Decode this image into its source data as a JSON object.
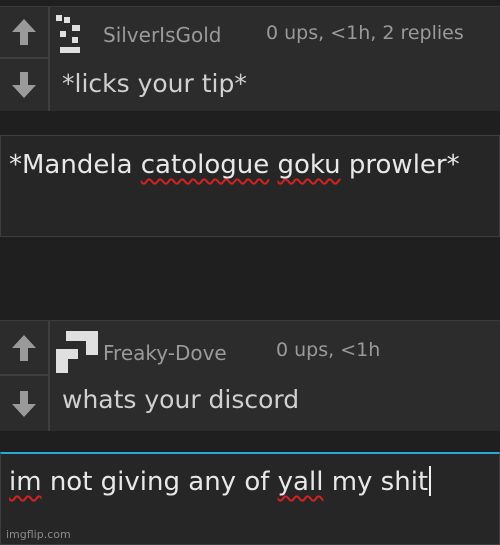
{
  "comments": [
    {
      "author": "SilverIsGold",
      "meta": "0 ups, <1h, 2 replies",
      "text": "*licks your tip*",
      "avatar_icon": "pixel-avatar-icon"
    },
    {
      "author": "Freaky-Dove",
      "meta": "0 ups, <1h",
      "text": "whats your discord",
      "avatar_icon": "pixel-avatar-icon"
    }
  ],
  "reply_box_1": {
    "parts": [
      "*Mandela ",
      "catologue",
      " ",
      "goku",
      " prowler*"
    ]
  },
  "reply_box_2": {
    "parts": [
      "im",
      " not giving any of ",
      "yall",
      " my shit"
    ]
  },
  "watermark": "imgflip.com",
  "colors": {
    "background": "#1f1f1f",
    "panel": "#2c2c2c",
    "reply_box_border": "#3e3e3e",
    "focus_border": "#2aa7d9",
    "spellcheck": "#d42121"
  }
}
